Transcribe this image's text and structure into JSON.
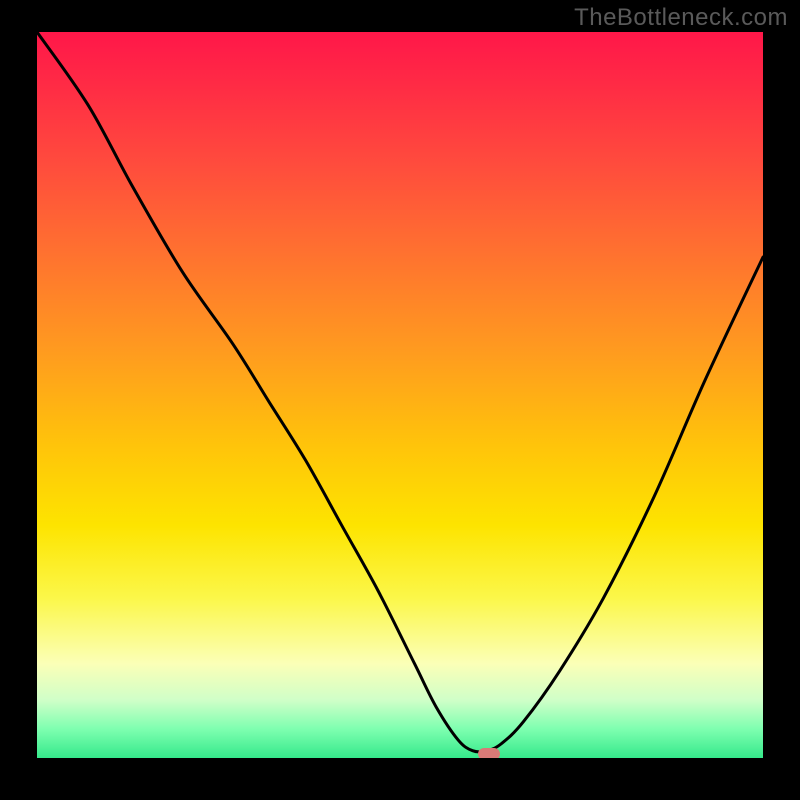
{
  "watermark": "TheBottleneck.com",
  "marker": {
    "x_frac": 0.623,
    "y_frac": 0.995
  },
  "chart_data": {
    "type": "line",
    "title": "",
    "xlabel": "",
    "ylabel": "",
    "xlim": [
      0,
      100
    ],
    "ylim": [
      0,
      100
    ],
    "series": [
      {
        "name": "bottleneck-curve",
        "x": [
          0,
          7,
          13,
          20,
          27,
          32,
          37,
          42,
          47,
          52,
          55,
          58,
          60,
          62,
          64,
          67,
          72,
          78,
          85,
          92,
          100
        ],
        "values": [
          100,
          90,
          79,
          67,
          57,
          49,
          41,
          32,
          23,
          13,
          7,
          2.5,
          1,
          1,
          2,
          5,
          12,
          22,
          36,
          52,
          69
        ]
      }
    ],
    "annotations": [
      {
        "type": "minimum-marker",
        "x": 62.3,
        "y": 0.5
      }
    ],
    "gradient_stops": [
      {
        "pct": 0,
        "color": "#ff1749"
      },
      {
        "pct": 7,
        "color": "#ff2a45"
      },
      {
        "pct": 18,
        "color": "#ff4b3d"
      },
      {
        "pct": 30,
        "color": "#ff7030"
      },
      {
        "pct": 44,
        "color": "#ff9b1f"
      },
      {
        "pct": 57,
        "color": "#ffc40a"
      },
      {
        "pct": 68,
        "color": "#fde400"
      },
      {
        "pct": 78,
        "color": "#fbf74a"
      },
      {
        "pct": 87,
        "color": "#fbffb7"
      },
      {
        "pct": 92,
        "color": "#d0ffc8"
      },
      {
        "pct": 96,
        "color": "#7effb0"
      },
      {
        "pct": 100,
        "color": "#35e98b"
      }
    ]
  }
}
